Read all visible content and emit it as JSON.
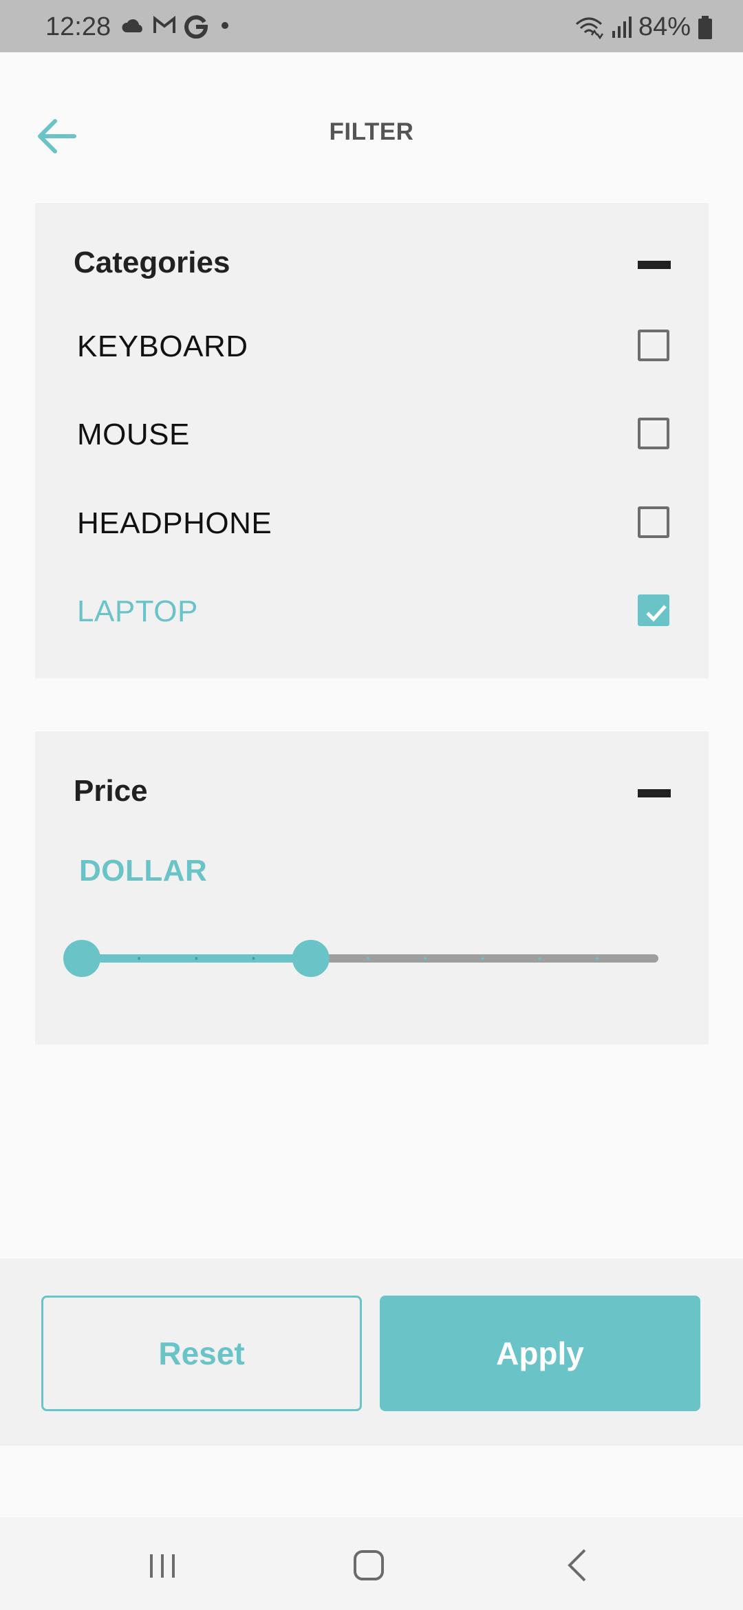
{
  "status_bar": {
    "time": "12:28",
    "battery_percent": "84%",
    "notification_icons": [
      "cloud-icon",
      "gmail-icon",
      "google-icon",
      "dot-icon"
    ],
    "system_icons": [
      "wifi-icon",
      "signal-icon",
      "battery-icon"
    ]
  },
  "header": {
    "title": "FILTER",
    "back_icon": "arrow-left-icon"
  },
  "categories": {
    "heading": "Categories",
    "collapse_icon": "minus-icon",
    "items": [
      {
        "label": "KEYBOARD",
        "checked": false
      },
      {
        "label": "MOUSE",
        "checked": false
      },
      {
        "label": "HEADPHONE",
        "checked": false
      },
      {
        "label": "LAPTOP",
        "checked": true
      }
    ]
  },
  "price": {
    "heading": "Price",
    "collapse_icon": "minus-icon",
    "currency": "DOLLAR",
    "slider": {
      "min_step": 0,
      "max_step": 10,
      "low_value": 0,
      "high_value": 4
    }
  },
  "actions": {
    "reset_label": "Reset",
    "apply_label": "Apply"
  },
  "colors": {
    "accent": "#6ac4c7",
    "text_dark": "#212121",
    "panel_bg": "#f1f1f1",
    "track_inactive": "#9e9e9e"
  },
  "nav_bar": {
    "icons": [
      "recents-icon",
      "home-icon",
      "back-nav-icon"
    ]
  }
}
